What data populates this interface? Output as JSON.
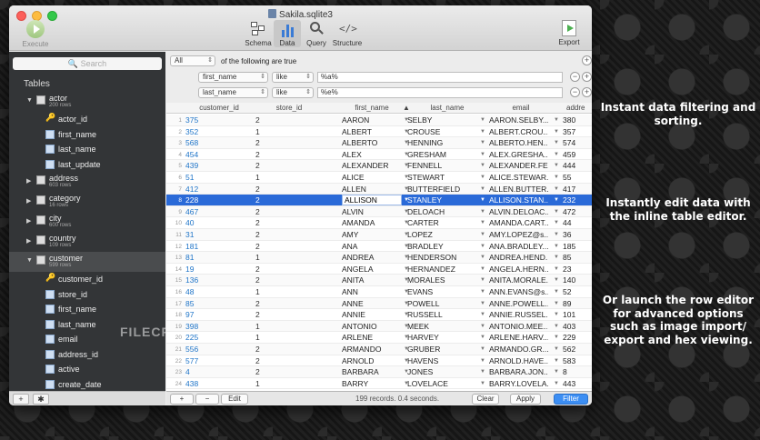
{
  "window": {
    "title": "Sakila.sqlite3",
    "toolbar": {
      "execute": "Execute",
      "schema": "Schema",
      "data": "Data",
      "query": "Query",
      "structure": "Structure",
      "export": "Export",
      "structure_glyph": "</>"
    }
  },
  "sidebar": {
    "search_placeholder": "Search",
    "heading": "Tables",
    "tables": [
      {
        "name": "actor",
        "rows": "200 rows",
        "expanded": true,
        "columns": [
          {
            "name": "actor_id",
            "key": true
          },
          {
            "name": "first_name"
          },
          {
            "name": "last_name"
          },
          {
            "name": "last_update"
          }
        ]
      },
      {
        "name": "address",
        "rows": "603 rows"
      },
      {
        "name": "category",
        "rows": "16 rows"
      },
      {
        "name": "city",
        "rows": "600 rows"
      },
      {
        "name": "country",
        "rows": "109 rows"
      },
      {
        "name": "customer",
        "rows": "599 rows",
        "expanded": true,
        "selected": true,
        "columns": [
          {
            "name": "customer_id",
            "key": true
          },
          {
            "name": "store_id"
          },
          {
            "name": "first_name"
          },
          {
            "name": "last_name"
          },
          {
            "name": "email"
          },
          {
            "name": "address_id"
          },
          {
            "name": "active"
          },
          {
            "name": "create_date"
          }
        ]
      }
    ],
    "footer": {
      "add": "+",
      "gear": "✱"
    }
  },
  "filter": {
    "match_mode": "All",
    "match_text": "of the following are true",
    "rules": [
      {
        "field": "first_name",
        "op": "like",
        "value": "%a%"
      },
      {
        "field": "last_name",
        "op": "like",
        "value": "%e%"
      }
    ],
    "plus": "+",
    "minus": "−"
  },
  "grid": {
    "columns": [
      "customer_id",
      "store_id",
      "first_name",
      "last_name",
      "email",
      "addre"
    ],
    "dropdown_glyph": "▼",
    "sort_glyph": "▲",
    "rows": [
      {
        "i": "1",
        "cid": "375",
        "sid": "2",
        "fn": "AARON",
        "ln": "SELBY",
        "em": "AARON.SELBY...",
        "ad": "380"
      },
      {
        "i": "2",
        "cid": "352",
        "sid": "1",
        "fn": "ALBERT",
        "ln": "CROUSE",
        "em": "ALBERT.CROU...",
        "ad": "357"
      },
      {
        "i": "3",
        "cid": "568",
        "sid": "2",
        "fn": "ALBERTO",
        "ln": "HENNING",
        "em": "ALBERTO.HEN...",
        "ad": "574"
      },
      {
        "i": "4",
        "cid": "454",
        "sid": "2",
        "fn": "ALEX",
        "ln": "GRESHAM",
        "em": "ALEX.GRESHA...",
        "ad": "459"
      },
      {
        "i": "5",
        "cid": "439",
        "sid": "2",
        "fn": "ALEXANDER",
        "ln": "FENNELL",
        "em": "ALEXANDER.FE...",
        "ad": "444"
      },
      {
        "i": "6",
        "cid": "51",
        "sid": "1",
        "fn": "ALICE",
        "ln": "STEWART",
        "em": "ALICE.STEWAR...",
        "ad": "55"
      },
      {
        "i": "7",
        "cid": "412",
        "sid": "2",
        "fn": "ALLEN",
        "ln": "BUTTERFIELD",
        "em": "ALLEN.BUTTER...",
        "ad": "417"
      },
      {
        "i": "8",
        "cid": "228",
        "sid": "2",
        "fn": "ALLISON",
        "ln": "STANLEY",
        "em": "ALLISON.STAN...",
        "ad": "232",
        "selected": true
      },
      {
        "i": "9",
        "cid": "467",
        "sid": "2",
        "fn": "ALVIN",
        "ln": "DELOACH",
        "em": "ALVIN.DELOAC...",
        "ad": "472"
      },
      {
        "i": "10",
        "cid": "40",
        "sid": "2",
        "fn": "AMANDA",
        "ln": "CARTER",
        "em": "AMANDA.CART...",
        "ad": "44"
      },
      {
        "i": "11",
        "cid": "31",
        "sid": "2",
        "fn": "AMY",
        "ln": "LOPEZ",
        "em": "AMY.LOPEZ@s...",
        "ad": "36"
      },
      {
        "i": "12",
        "cid": "181",
        "sid": "2",
        "fn": "ANA",
        "ln": "BRADLEY",
        "em": "ANA.BRADLEY...",
        "ad": "185"
      },
      {
        "i": "13",
        "cid": "81",
        "sid": "1",
        "fn": "ANDREA",
        "ln": "HENDERSON",
        "em": "ANDREA.HEND...",
        "ad": "85"
      },
      {
        "i": "14",
        "cid": "19",
        "sid": "2",
        "fn": "ANGELA",
        "ln": "HERNANDEZ",
        "em": "ANGELA.HERN...",
        "ad": "23"
      },
      {
        "i": "15",
        "cid": "136",
        "sid": "2",
        "fn": "ANITA",
        "ln": "MORALES",
        "em": "ANITA.MORALE...",
        "ad": "140"
      },
      {
        "i": "16",
        "cid": "48",
        "sid": "1",
        "fn": "ANN",
        "ln": "EVANS",
        "em": "ANN.EVANS@s...",
        "ad": "52"
      },
      {
        "i": "17",
        "cid": "85",
        "sid": "2",
        "fn": "ANNE",
        "ln": "POWELL",
        "em": "ANNE.POWELL...",
        "ad": "89"
      },
      {
        "i": "18",
        "cid": "97",
        "sid": "2",
        "fn": "ANNIE",
        "ln": "RUSSELL",
        "em": "ANNIE.RUSSEL...",
        "ad": "101"
      },
      {
        "i": "19",
        "cid": "398",
        "sid": "1",
        "fn": "ANTONIO",
        "ln": "MEEK",
        "em": "ANTONIO.MEE...",
        "ad": "403"
      },
      {
        "i": "20",
        "cid": "225",
        "sid": "1",
        "fn": "ARLENE",
        "ln": "HARVEY",
        "em": "ARLENE.HARV...",
        "ad": "229"
      },
      {
        "i": "21",
        "cid": "556",
        "sid": "2",
        "fn": "ARMANDO",
        "ln": "GRUBER",
        "em": "ARMANDO.GR...",
        "ad": "562"
      },
      {
        "i": "22",
        "cid": "577",
        "sid": "2",
        "fn": "ARNOLD",
        "ln": "HAVENS",
        "em": "ARNOLD.HAVE...",
        "ad": "583"
      },
      {
        "i": "23",
        "cid": "4",
        "sid": "2",
        "fn": "BARBARA",
        "ln": "JONES",
        "em": "BARBARA.JON...",
        "ad": "8"
      },
      {
        "i": "24",
        "cid": "438",
        "sid": "1",
        "fn": "BARRY",
        "ln": "LOVELACE",
        "em": "BARRY.LOVELA...",
        "ad": "443"
      }
    ]
  },
  "status": {
    "add": "+",
    "remove": "−",
    "edit": "Edit",
    "records": "199 records. 0.4 seconds.",
    "clear": "Clear",
    "apply": "Apply",
    "filter": "Filter"
  },
  "captions": [
    [
      "Instant data filtering and",
      "sorting."
    ],
    [
      "Instantly edit data with",
      "the inline table editor."
    ],
    [
      "Or launch the row editor",
      "for advanced options",
      "such as image import/",
      "export and hex viewing."
    ]
  ],
  "watermark": "FILECR"
}
